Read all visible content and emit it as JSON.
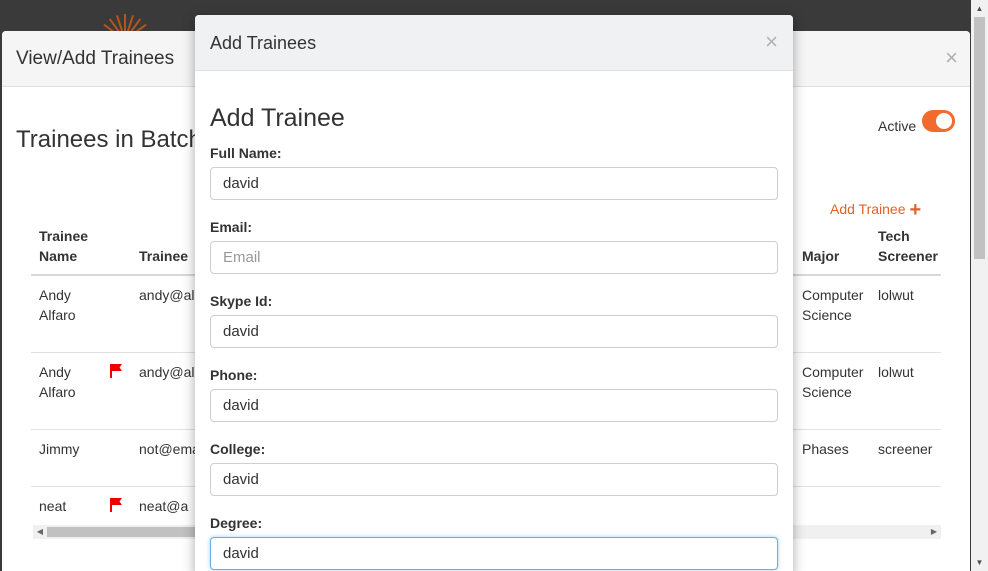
{
  "back_modal": {
    "title": "View/Add Trainees",
    "close_glyph": "×",
    "batch_title": "Trainees in Batch",
    "active_label": "Active",
    "active_on": true,
    "add_trainee_label": "Add Trainee",
    "add_trainee_icon": "+",
    "accent_color": "#f26b2c",
    "table": {
      "headers": {
        "name_line1": "Trainee",
        "name_line2": "Name",
        "email": "Trainee",
        "major": "Major",
        "screener_line1": "Tech",
        "screener_line2": "Screener"
      },
      "rows": [
        {
          "name_line1": "Andy",
          "name_line2": "Alfaro",
          "flag": false,
          "email": "andy@al",
          "major_line1": "Computer",
          "major_line2": "Science",
          "screener": "lolwut"
        },
        {
          "name_line1": "Andy",
          "name_line2": "Alfaro",
          "flag": true,
          "email": "andy@al",
          "major_line1": "Computer",
          "major_line2": "Science",
          "screener": "lolwut"
        },
        {
          "name_line1": "Jimmy",
          "name_line2": "",
          "flag": false,
          "email": "not@ema",
          "major_line1": "Phases",
          "major_line2": "",
          "screener": "screener"
        },
        {
          "name_line1": "neat",
          "name_line2": "",
          "flag": true,
          "email": "neat@a",
          "major_line1": "",
          "major_line2": "",
          "screener": ""
        }
      ]
    }
  },
  "front_modal": {
    "title": "Add Trainees",
    "close_glyph": "×",
    "form_title": "Add Trainee",
    "fields": {
      "full_name": {
        "label": "Full Name:",
        "value": "david",
        "placeholder": ""
      },
      "email": {
        "label": "Email:",
        "value": "",
        "placeholder": "Email"
      },
      "skype": {
        "label": "Skype Id:",
        "value": "david",
        "placeholder": ""
      },
      "phone": {
        "label": "Phone:",
        "value": "david",
        "placeholder": ""
      },
      "college": {
        "label": "College:",
        "value": "david",
        "placeholder": ""
      },
      "degree": {
        "label": "Degree:",
        "value": "david",
        "placeholder": ""
      }
    }
  },
  "icons": {
    "flag": "flag-icon",
    "close": "close-icon",
    "plus": "plus-icon"
  }
}
